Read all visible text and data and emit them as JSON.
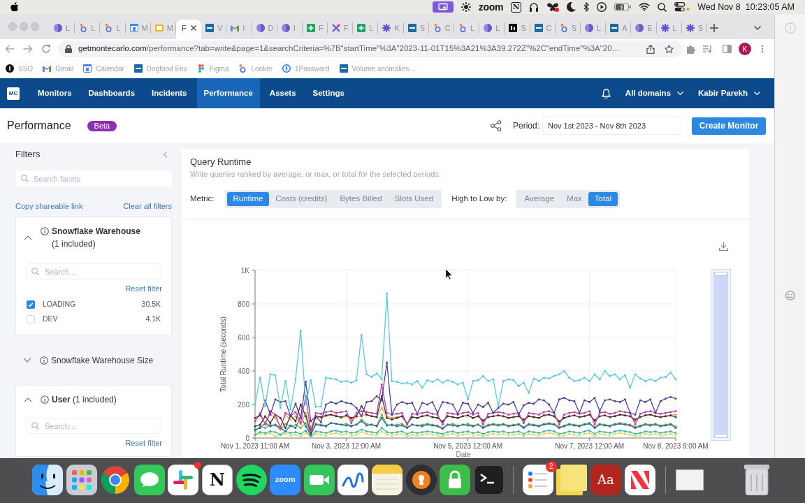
{
  "menu_bar": {
    "status_items": [
      {
        "kind": "screen-share"
      },
      {
        "kind": "sun"
      },
      {
        "kind": "wordmark",
        "text": "zoom"
      },
      {
        "kind": "letter-box",
        "text": "N"
      },
      {
        "kind": "headphones"
      },
      {
        "kind": "butterfly"
      },
      {
        "kind": "moon"
      },
      {
        "kind": "bluetooth"
      },
      {
        "kind": "play"
      },
      {
        "kind": "battery"
      },
      {
        "kind": "wifi"
      },
      {
        "kind": "search"
      },
      {
        "kind": "toggles"
      }
    ],
    "date": "Wed Nov 8",
    "time": "10:23:05 AM"
  },
  "browser": {
    "tabs": [
      {
        "kind": "disc",
        "title": "L",
        "selected": false
      },
      {
        "kind": "ring",
        "title": "L",
        "selected": false
      },
      {
        "kind": "ring",
        "title": "L",
        "selected": false
      },
      {
        "kind": "calendar",
        "title": "M",
        "selected": false
      },
      {
        "kind": "slides",
        "title": "M",
        "selected": false
      },
      {
        "title": "F",
        "selected": true
      },
      {
        "kind": "tile",
        "title": "V",
        "selected": false
      },
      {
        "kind": "mail",
        "title": "I",
        "selected": false
      },
      {
        "kind": "disc",
        "title": "D",
        "selected": false
      },
      {
        "kind": "disc",
        "title": "I",
        "selected": false
      },
      {
        "kind": "sheet",
        "title": "F",
        "selected": false
      },
      {
        "kind": "cross",
        "title": "F",
        "selected": false
      },
      {
        "kind": "sheet",
        "title": "L",
        "selected": false
      },
      {
        "kind": "gear",
        "title": "K",
        "selected": false
      },
      {
        "kind": "tile",
        "title": "S",
        "selected": false
      },
      {
        "kind": "ring",
        "title": "C",
        "selected": false
      },
      {
        "kind": "ring",
        "title": "L",
        "selected": false
      },
      {
        "kind": "disc",
        "title": "L",
        "selected": false
      },
      {
        "kind": "square",
        "title": "S",
        "selected": false
      },
      {
        "kind": "tile",
        "title": "C",
        "selected": false
      },
      {
        "kind": "ring",
        "title": "S",
        "selected": false
      },
      {
        "kind": "disc",
        "title": "L",
        "selected": false
      },
      {
        "kind": "tile",
        "title": "A",
        "selected": false
      },
      {
        "kind": "disc",
        "title": "E",
        "selected": false
      },
      {
        "kind": "gear",
        "title": "L",
        "selected": false
      },
      {
        "kind": "gear",
        "title": "S",
        "selected": false
      }
    ],
    "address": {
      "host": "getmontecarlo.com",
      "path": "/performance?tab=write&page=1&searchCriteria=%7B\"startTime\"%3A\"2023-11-01T15%3A21%3A39.272Z\"%2C\"endTime\"%3A\"20…"
    },
    "profile_initial": "K",
    "bookmarks": [
      {
        "kind": "badge",
        "label": "SSO"
      },
      {
        "kind": "mail",
        "label": "Gmail"
      },
      {
        "kind": "calendar",
        "label": "Calendar"
      },
      {
        "kind": "tile",
        "label": "Dogfood Env"
      },
      {
        "kind": "dots",
        "label": "Figma"
      },
      {
        "kind": "ring",
        "label": "Looker"
      },
      {
        "kind": "keyhole",
        "label": "1Password"
      },
      {
        "kind": "tile",
        "label": "Volume anomalies…"
      }
    ]
  },
  "app": {
    "nav": {
      "logo": "MC",
      "items": [
        {
          "label": "Monitors",
          "selected": false
        },
        {
          "label": "Dashboards",
          "selected": false
        },
        {
          "label": "Incidents",
          "selected": false
        },
        {
          "label": "Performance",
          "selected": true
        },
        {
          "label": "Assets",
          "selected": false
        },
        {
          "label": "Settings",
          "selected": false
        }
      ],
      "domain_menu": "All domains",
      "user_menu": "Kabir Parekh"
    },
    "header": {
      "title": "Performance",
      "badge": "Beta",
      "period_label": "Period:",
      "period": "Nov 1st 2023 - Nov 8th 2023",
      "create_button": "Create Monitor"
    },
    "filters": {
      "title": "Filters",
      "search_placeholder": "Search facets",
      "copy_link": "Copy shareable link",
      "clear_link": "Clear all filters",
      "facets": [
        {
          "label": "**Snowflake Warehouse** (1 included)",
          "expanded": true,
          "search_placeholder": "Search...",
          "reset": "Reset filter",
          "options": [
            {
              "label": "LOADING",
              "count": "30.5K",
              "checked": true
            },
            {
              "label": "DEV",
              "count": "4.1K",
              "checked": false
            }
          ]
        },
        {
          "label": "Snowflake Warehouse Size",
          "expanded": false
        },
        {
          "label": "**User** (1 included)",
          "expanded": true,
          "search_placeholder": "Search...",
          "reset": "Reset filter"
        }
      ]
    },
    "main": {
      "title": "Query Runtime",
      "subtitle": "Write queries ranked by average, or max, or total for the selected periods.",
      "metric_label": "Metric:",
      "metrics": [
        {
          "label": "Runtime",
          "selected": true
        },
        {
          "label": "Costs (credits)",
          "selected": false
        },
        {
          "label": "Bytes Billed",
          "selected": false
        },
        {
          "label": "Slots Used",
          "selected": false
        }
      ],
      "sort_label": "High to Low by:",
      "sort_options": [
        {
          "label": "Average",
          "selected": false
        },
        {
          "label": "Max",
          "selected": false
        },
        {
          "label": "Total",
          "selected": true
        }
      ],
      "chart_data": {
        "type": "line",
        "xlabel": "Date",
        "ylabel": "Total Runtime (seconds)",
        "grid": true,
        "categories": [
          "Nov 1, 2023 11:00 AM",
          null,
          null,
          null,
          null,
          null,
          null,
          null,
          null,
          null,
          null,
          null,
          null,
          null,
          null,
          null,
          null,
          null,
          "Nov 3, 2023 12:00 AM",
          null,
          null,
          null,
          null,
          null,
          null,
          null,
          null,
          null,
          null,
          null,
          null,
          null,
          null,
          null,
          null,
          null,
          null,
          null,
          null,
          null,
          null,
          null,
          "Nov 5, 2023 12:00 AM",
          null,
          null,
          null,
          null,
          null,
          null,
          null,
          null,
          null,
          null,
          null,
          null,
          null,
          null,
          null,
          null,
          null,
          null,
          null,
          null,
          null,
          null,
          null,
          "Nov 7, 2023 12:00 AM",
          null,
          null,
          null,
          null,
          null,
          null,
          null,
          null,
          null,
          null,
          null,
          null,
          null,
          null,
          null,
          null,
          "Nov 8, 2023 9:00 AM"
        ],
        "ylim": [
          0,
          1000
        ],
        "yticks": [
          0,
          200,
          400,
          600,
          800,
          {
            "value": 1000,
            "label": "1K"
          }
        ],
        "series": [
          {
            "color": "#56cbe3",
            "values": [
              200,
              360,
              190,
              380,
              375,
              180,
              340,
              170,
              350,
              640,
              200,
              345,
              185,
              190,
              360,
              355,
              350,
              335,
              340,
              330,
              345,
              615,
              380,
              365,
              385,
              350,
              860,
              340,
              335,
              325,
              330,
              320,
              340,
              300,
              345,
              335,
              350,
              330,
              345,
              335,
              320,
              330,
              230,
              340,
              345,
              370,
              340,
              350,
              190,
              340,
              350,
              345,
              310,
              330,
              270,
              355,
              340,
              360,
              355,
              370,
              380,
              400,
              360,
              340,
              345,
              360,
              340,
              380,
              350,
              400,
              370,
              380,
              350,
              375,
              300,
              380,
              355,
              340,
              350,
              340,
              360,
              365,
              390,
              350
            ]
          },
          {
            "color": "#4b4496",
            "values": [
              120,
              135,
              225,
              140,
              230,
              215,
              220,
              130,
              205,
              120,
              335,
              100,
              130,
              95,
              200,
              215,
              205,
              220,
              210,
              205,
              180,
              130,
              215,
              220,
              250,
              225,
              450,
              140,
              200,
              215,
              205,
              210,
              145,
              210,
              200,
              215,
              150,
              215,
              210,
              200,
              145,
              210,
              205,
              150,
              200,
              185,
              210,
              150,
              180,
              205,
              200,
              215,
              140,
              195,
              210,
              205,
              230,
              225,
              200,
              150,
              230,
              240,
              225,
              220,
              150,
              225,
              215,
              240,
              160,
              225,
              230,
              220,
              215,
              230,
              150,
              140,
              225,
              215,
              230,
              150,
              220,
              235,
              245,
              235
            ]
          },
          {
            "color": "#c33ea8",
            "values": [
              100,
              150,
              80,
              160,
              140,
              60,
              150,
              130,
              155,
              90,
              250,
              40,
              150,
              145,
              155,
              160,
              150,
              155,
              160,
              90,
              150,
              160,
              155,
              150,
              145,
              320,
              150,
              140,
              145,
              150,
              80,
              145,
              140,
              150,
              155,
              145,
              140,
              80,
              150,
              145,
              140,
              150,
              155,
              140,
              150,
              80,
              145,
              150,
              155,
              150,
              140,
              145,
              150,
              90,
              150,
              145,
              140,
              155,
              160,
              150,
              80,
              140,
              150,
              155,
              145,
              150,
              160,
              80,
              150,
              155,
              145,
              150,
              160,
              155,
              150,
              80,
              145,
              155,
              160,
              150,
              145,
              150,
              155,
              160
            ]
          },
          {
            "color": "#383838",
            "values": [
              70,
              80,
              130,
              90,
              140,
              120,
              60,
              135,
              100,
              200,
              130,
              30,
              130,
              125,
              135,
              140,
              130,
              125,
              135,
              120,
              130,
              190,
              140,
              130,
              125,
              250,
              120,
              110,
              120,
              130,
              85,
              125,
              120,
              130,
              135,
              125,
              120,
              100,
              130,
              125,
              120,
              130,
              135,
              120,
              130,
              105,
              125,
              130,
              135,
              130,
              120,
              125,
              130,
              110,
              130,
              125,
              120,
              135,
              140,
              130,
              100,
              120,
              130,
              135,
              125,
              130,
              140,
              105,
              130,
              135,
              125,
              130,
              140,
              135,
              130,
              110,
              125,
              135,
              140,
              130,
              125,
              130,
              135,
              125
            ]
          },
          {
            "color": "#f2a24f",
            "values": [
              110,
              130,
              90,
              140,
              120,
              70,
              135,
              110,
              130,
              80,
              150,
              60,
              120,
              125,
              130,
              140,
              135,
              120,
              130,
              110,
              125,
              135,
              140,
              130,
              125,
              180,
              130,
              120,
              125,
              130,
              90,
              125,
              120,
              130,
              135,
              125,
              120,
              95,
              130,
              125,
              120,
              130,
              135,
              120,
              130,
              100,
              125,
              130,
              135,
              130,
              120,
              125,
              130,
              100,
              130,
              125,
              120,
              135,
              140,
              130,
              95,
              120,
              130,
              135,
              125,
              130,
              140,
              100,
              130,
              135,
              125,
              130,
              140,
              135,
              130,
              100,
              125,
              135,
              140,
              130,
              125,
              130,
              135,
              140
            ]
          },
          {
            "color": "#2f67b1",
            "values": [
              50,
              60,
              90,
              70,
              80,
              60,
              40,
              75,
              60,
              130,
              70,
              20,
              80,
              75,
              70,
              90,
              85,
              80,
              75,
              70,
              80,
              100,
              75,
              80,
              70,
              120,
              75,
              80,
              70,
              75,
              60,
              80,
              75,
              70,
              80,
              75,
              70,
              55,
              80,
              75,
              70,
              80,
              75,
              70,
              80,
              60,
              75,
              80,
              75,
              80,
              70,
              75,
              80,
              60,
              80,
              75,
              70,
              80,
              85,
              80,
              60,
              70,
              80,
              75,
              70,
              80,
              85,
              60,
              80,
              75,
              70,
              80,
              85,
              80,
              75,
              60,
              70,
              80,
              75,
              80,
              70,
              75,
              80,
              60
            ]
          },
          {
            "color": "#72b545",
            "values": [
              40,
              70,
              60,
              80,
              75,
              50,
              85,
              70,
              80,
              60,
              90,
              30,
              85,
              80,
              75,
              90,
              85,
              80,
              85,
              75,
              80,
              110,
              85,
              80,
              75,
              140,
              80,
              75,
              80,
              85,
              65,
              80,
              75,
              80,
              85,
              80,
              75,
              60,
              80,
              85,
              75,
              80,
              85,
              75,
              80,
              65,
              80,
              85,
              80,
              85,
              75,
              80,
              85,
              65,
              85,
              80,
              75,
              85,
              90,
              85,
              65,
              75,
              85,
              80,
              75,
              85,
              90,
              65,
              85,
              80,
              75,
              85,
              90,
              85,
              80,
              65,
              75,
              85,
              80,
              85,
              75,
              80,
              85,
              70
            ]
          },
          {
            "color": "#3bb6a6",
            "values": [
              20,
              35,
              30,
              40,
              35,
              20,
              40,
              30,
              35,
              25,
              45,
              10,
              40,
              35,
              30,
              40,
              45,
              35,
              40,
              30,
              35,
              50,
              40,
              35,
              30,
              60,
              35,
              30,
              35,
              40,
              25,
              35,
              30,
              35,
              40,
              35,
              30,
              25,
              35,
              40,
              30,
              35,
              40,
              30,
              35,
              25,
              35,
              40,
              35,
              40,
              30,
              35,
              40,
              25,
              40,
              35,
              30,
              40,
              45,
              40,
              25,
              30,
              40,
              35,
              30,
              40,
              45,
              25,
              40,
              35,
              30,
              40,
              45,
              40,
              35,
              25,
              30,
              40,
              35,
              40,
              30,
              35,
              40,
              30
            ]
          },
          {
            "color": "#d6e05a",
            "values": [
              15,
              25,
              20,
              30,
              10,
              20,
              25,
              15,
              20,
              10,
              30,
              5,
              25,
              20,
              15,
              25,
              30,
              20,
              25,
              15,
              20,
              35,
              25,
              20,
              15,
              40,
              20,
              15,
              20,
              25,
              10,
              20,
              15,
              20,
              25,
              20,
              15,
              10,
              20,
              25,
              15,
              20,
              25,
              15,
              20,
              10,
              20,
              25,
              20,
              25,
              15,
              20,
              25,
              10,
              25,
              20,
              15,
              25,
              30,
              25,
              10,
              15,
              25,
              20,
              15,
              25,
              30,
              10,
              25,
              20,
              15,
              25,
              30,
              25,
              20,
              10,
              15,
              25,
              20,
              25,
              15,
              20,
              25,
              15
            ]
          }
        ]
      },
      "zoom_slider": {
        "level": 1
      }
    }
  },
  "dock": {
    "apps": [
      {
        "kind": "finder"
      },
      {
        "kind": "launchpad"
      },
      {
        "kind": "chrome"
      },
      {
        "kind": "messages"
      },
      {
        "kind": "slack"
      },
      {
        "kind": "notion",
        "text": "N"
      },
      {
        "kind": "spotify"
      },
      {
        "kind": "zoom",
        "text": "zoom"
      },
      {
        "kind": "facetime"
      },
      {
        "kind": "freeform"
      },
      {
        "kind": "notes"
      },
      {
        "kind": "vpn"
      },
      {
        "kind": "lock"
      },
      {
        "kind": "terminal"
      }
    ],
    "recent": [
      {
        "kind": "reminders",
        "badge": "2"
      },
      {
        "kind": "stickies"
      },
      {
        "kind": "dictionary",
        "text": "Aa"
      },
      {
        "kind": "news"
      }
    ],
    "others": [
      {
        "kind": "window"
      },
      {
        "kind": "trash"
      }
    ]
  }
}
